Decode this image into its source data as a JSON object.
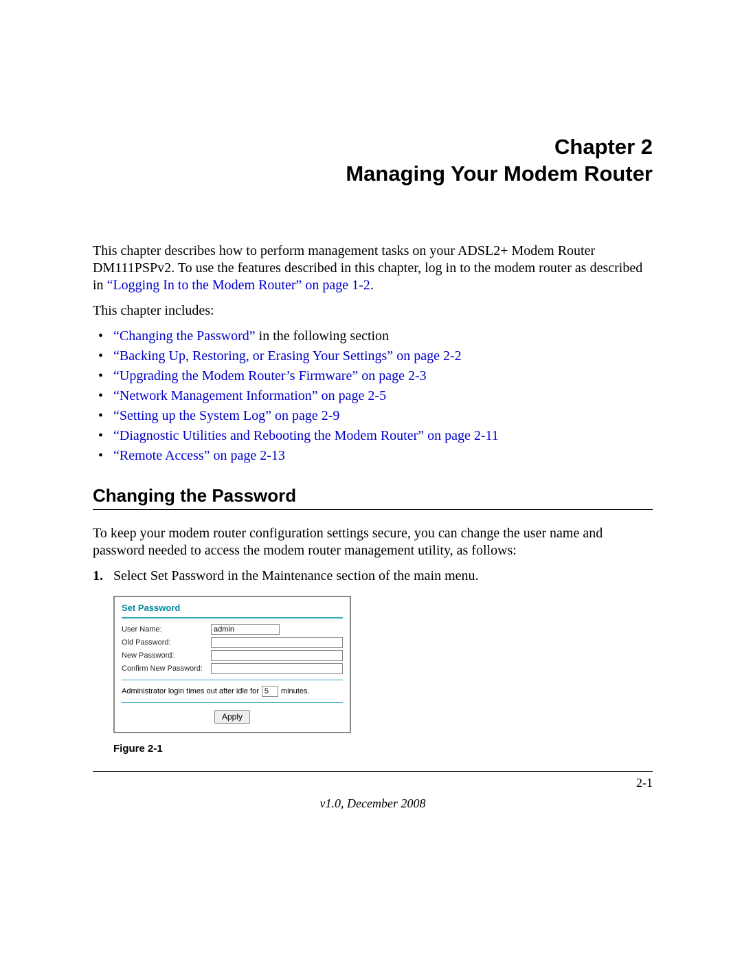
{
  "chapter": {
    "line1": "Chapter 2",
    "line2": "Managing Your Modem Router"
  },
  "intro": {
    "text_before_link": "This chapter describes how to perform management tasks on your ADSL2+ Modem Router DM111PSPv2. To use the features described in this chapter, log in to the modem router as described in ",
    "link": "“Logging In to the Modem Router” on page 1-2",
    "text_after_link": "."
  },
  "includes_label": "This chapter includes:",
  "bullets": {
    "b1_link": "“Changing the Password”",
    "b1_tail": " in the following section",
    "b2": "“Backing Up, Restoring, or Erasing Your Settings” on page 2-2",
    "b3": "“Upgrading the Modem Router’s Firmware” on page 2-3",
    "b4": "“Network Management Information” on page 2-5",
    "b5": "“Setting up the System Log” on page 2-9",
    "b6": "“Diagnostic Utilities and Rebooting the Modem Router” on page 2-11",
    "b7": "“Remote Access” on page 2-13"
  },
  "section_heading": "Changing the Password",
  "section_intro": "To keep your modem router configuration settings secure, you can change the user name and password needed to access the modem router management utility, as follows:",
  "step1": {
    "num": "1.",
    "text": "Select Set Password in the Maintenance section of the main menu."
  },
  "panel": {
    "title": "Set Password",
    "username_label": "User Name:",
    "username_value": "admin",
    "oldpw_label": "Old Password:",
    "newpw_label": "New Password:",
    "confirmpw_label": "Confirm New Password:",
    "idle_before": "Administrator login times out after idle for",
    "idle_value": "5",
    "idle_after": "minutes.",
    "apply": "Apply"
  },
  "figure_caption": "Figure 2-1",
  "footer": {
    "page": "2-1",
    "version": "v1.0, December 2008"
  }
}
